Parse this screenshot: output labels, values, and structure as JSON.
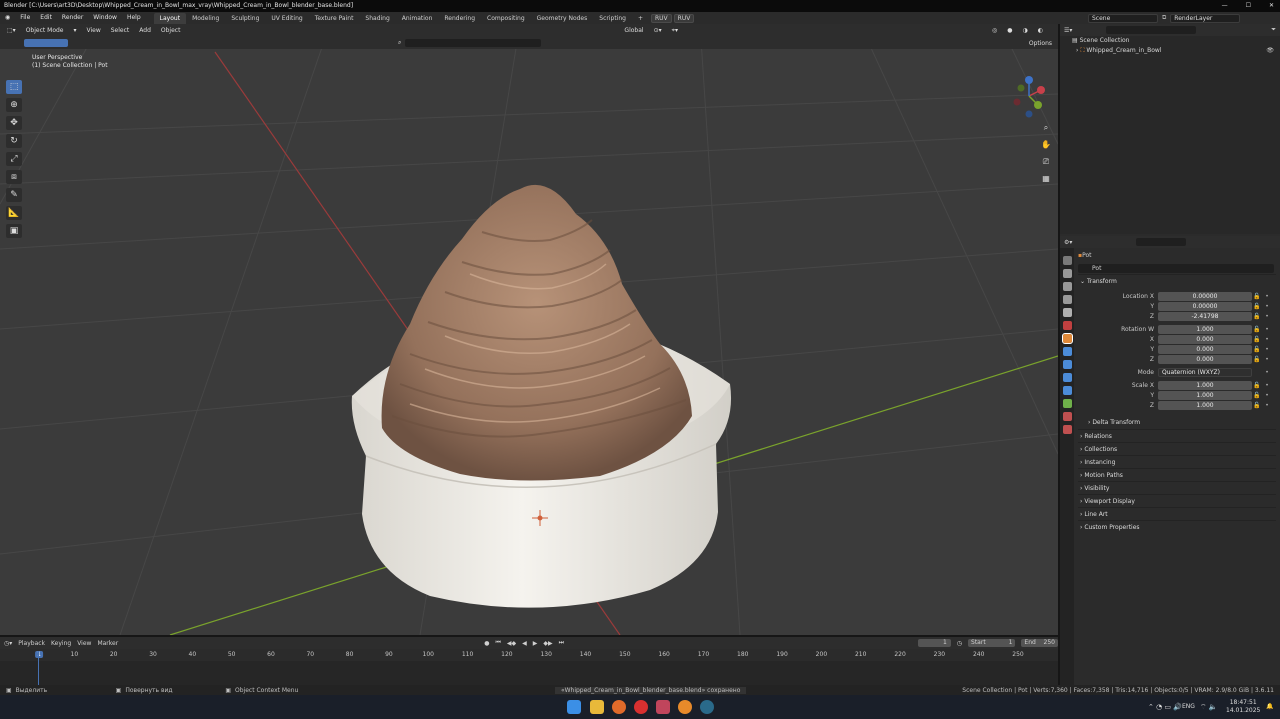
{
  "window": {
    "title": "Blender [C:\\Users\\art3D\\Desktop\\Whipped_Cream_in_Bowl_max_vray\\Whipped_Cream_in_Bowl_blender_base.blend]"
  },
  "menu": [
    "File",
    "Edit",
    "Render",
    "Window",
    "Help"
  ],
  "workspaces": [
    "Layout",
    "Modeling",
    "Sculpting",
    "UV Editing",
    "Texture Paint",
    "Shading",
    "Animation",
    "Rendering",
    "Compositing",
    "Geometry Nodes",
    "Scripting"
  ],
  "ruv": [
    "RUV",
    "RUV"
  ],
  "scene": {
    "name": "Scene",
    "layer": "RenderLayer"
  },
  "viewport": {
    "mode": "Object Mode",
    "menus": [
      "View",
      "Select",
      "Add",
      "Object"
    ],
    "orientation": "Global",
    "options": "Options",
    "info_line1": "User Perspective",
    "info_line2": "(1) Scene Collection | Pot"
  },
  "outliner": {
    "root": "Scene Collection",
    "object": "Whipped_Cream_in_Bowl"
  },
  "properties": {
    "object_name": "Pot",
    "data_name": "Pot",
    "transform_header": "Transform",
    "location": {
      "label": "Location X",
      "x": "0.00000",
      "y": "0.00000",
      "z": "-2.41798"
    },
    "rotation": {
      "label": "Rotation W",
      "w": "1.000",
      "x": "0.000",
      "y": "0.000",
      "z": "0.000"
    },
    "mode_label": "Mode",
    "mode_value": "Quaternion (WXYZ)",
    "scale": {
      "label": "Scale X",
      "x": "1.000",
      "y": "1.000",
      "z": "1.000"
    },
    "axis": {
      "y": "Y",
      "z": "Z",
      "x": "X"
    },
    "delta": "Delta Transform",
    "panels": [
      "Relations",
      "Collections",
      "Instancing",
      "Motion Paths",
      "Visibility",
      "Viewport Display",
      "Line Art",
      "Custom Properties"
    ]
  },
  "timeline": {
    "menus": [
      "Playback",
      "Keying",
      "View",
      "Marker"
    ],
    "current_frame": "1",
    "start_label": "Start",
    "start": "1",
    "end_label": "End",
    "end": "250",
    "ticks": [
      "1",
      "10",
      "20",
      "30",
      "40",
      "50",
      "60",
      "70",
      "80",
      "90",
      "100",
      "110",
      "120",
      "130",
      "140",
      "150",
      "160",
      "170",
      "180",
      "190",
      "200",
      "210",
      "220",
      "230",
      "240",
      "250"
    ]
  },
  "status": {
    "select": "Выделить",
    "rotate": "Повернуть вид",
    "context": "Object Context Menu",
    "saved": "«Whipped_Cream_in_Bowl_blender_base.blend» сохранено",
    "stats": "Scene Collection | Pot | Verts:7,360 | Faces:7,358 | Tris:14,716 | Objects:0/5 | VRAM: 2.9/8.0 GiB | 3.6.11"
  },
  "taskbar": {
    "lang": "ENG",
    "time": "18:47:51",
    "date": "14.01.2025"
  },
  "colors": {
    "accent": "#4772b3",
    "cream": "#9c7a63",
    "bowl": "#f2f0ea",
    "grid": "#474747",
    "xaxis": "#9a3b3b",
    "yaxis": "#7aa32c"
  }
}
